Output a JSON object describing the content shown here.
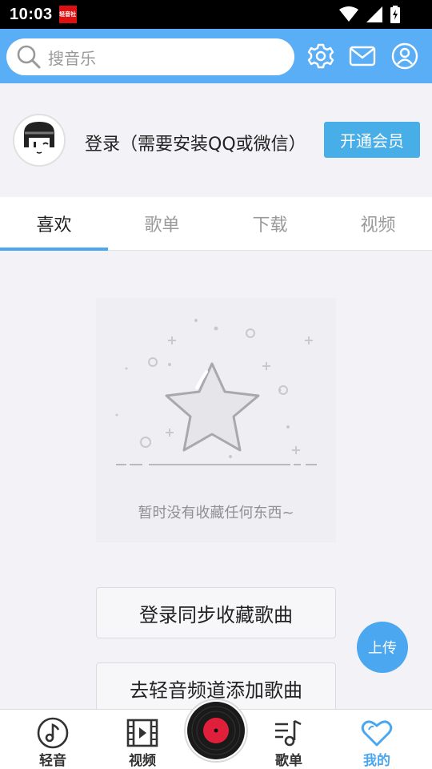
{
  "status_bar": {
    "time": "10:03",
    "app_badge": "轻音社"
  },
  "header": {
    "search_placeholder": "搜音乐"
  },
  "profile": {
    "login_text": "登录（需要安装QQ或微信）",
    "vip_button": "开通会员"
  },
  "tabs": [
    {
      "label": "喜欢",
      "active": true
    },
    {
      "label": "歌单",
      "active": false
    },
    {
      "label": "下载",
      "active": false
    },
    {
      "label": "视频",
      "active": false
    }
  ],
  "empty_state": {
    "message": "暂时没有收藏任何东西~"
  },
  "actions": {
    "login_sync": "登录同步收藏歌曲",
    "add_songs": "去轻音频道添加歌曲"
  },
  "upload_button": "上传",
  "bottom_nav": [
    {
      "label": "轻音",
      "icon": "music-note-icon"
    },
    {
      "label": "视频",
      "icon": "video-icon"
    },
    {
      "label": "歌单",
      "icon": "playlist-icon"
    },
    {
      "label": "我的",
      "icon": "heart-icon",
      "active": true
    }
  ],
  "colors": {
    "accent": "#4ba7ef",
    "header": "#5aaef5",
    "record_center": "#e0203a"
  }
}
